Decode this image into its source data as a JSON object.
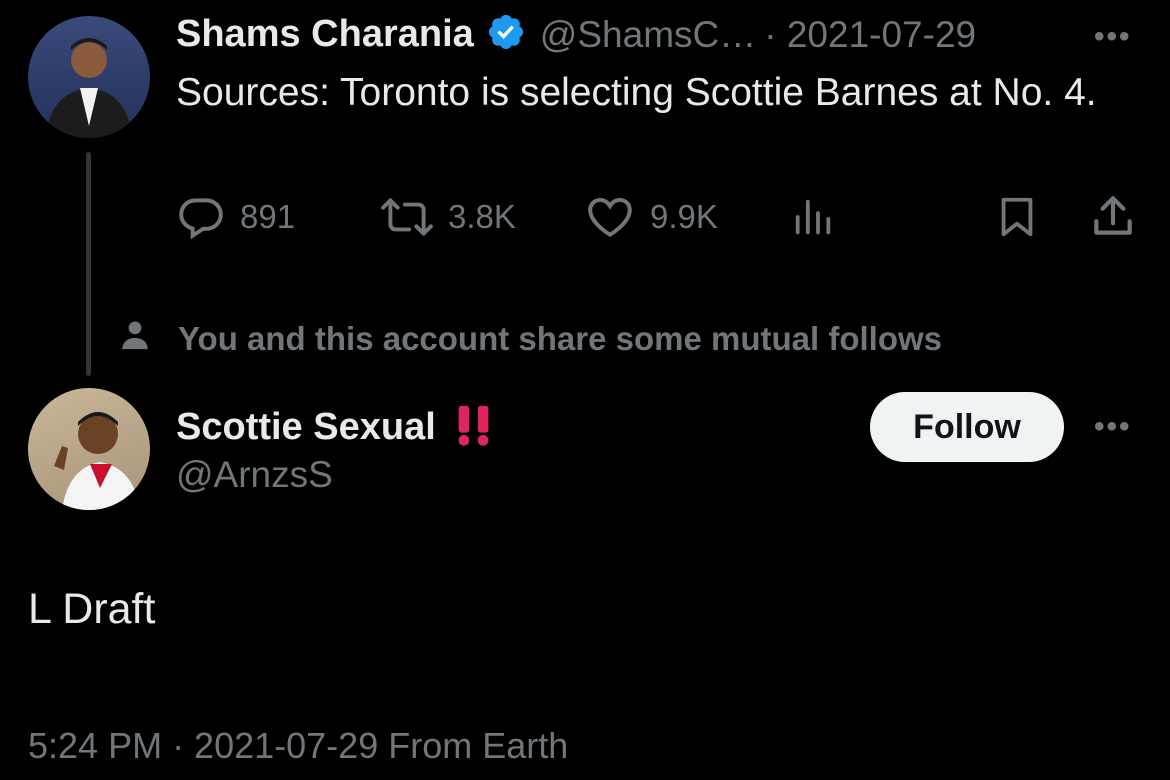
{
  "quoted_tweet": {
    "author_name": "Shams Charania",
    "handle": "@ShamsC…",
    "date": "· 2021-07-29",
    "more": "•••",
    "text": "Sources: Toronto is selecting Scottie Barnes at No. 4.",
    "actions": {
      "replies": "891",
      "retweets": "3.8K",
      "likes": "9.9K"
    },
    "icons": [
      "reply-icon",
      "retweet-icon",
      "like-icon",
      "views-icon",
      "bookmark-icon",
      "share-icon"
    ]
  },
  "mutual_notice": "You and this account share some mutual follows",
  "reply_tweet": {
    "author_name": "Scottie Sexual",
    "emoji": "‼️",
    "handle": "@ArnzsS",
    "follow_label": "Follow",
    "more": "•••",
    "text": "L Draft",
    "timestamp": "5:24 PM · 2021-07-29 From Earth"
  },
  "colors": {
    "background": "#000000",
    "text": "#e7e9ea",
    "muted": "#71767b",
    "verified": "#1d9bf0",
    "follow_bg": "#eff3f4",
    "bang": "#e0245e"
  }
}
